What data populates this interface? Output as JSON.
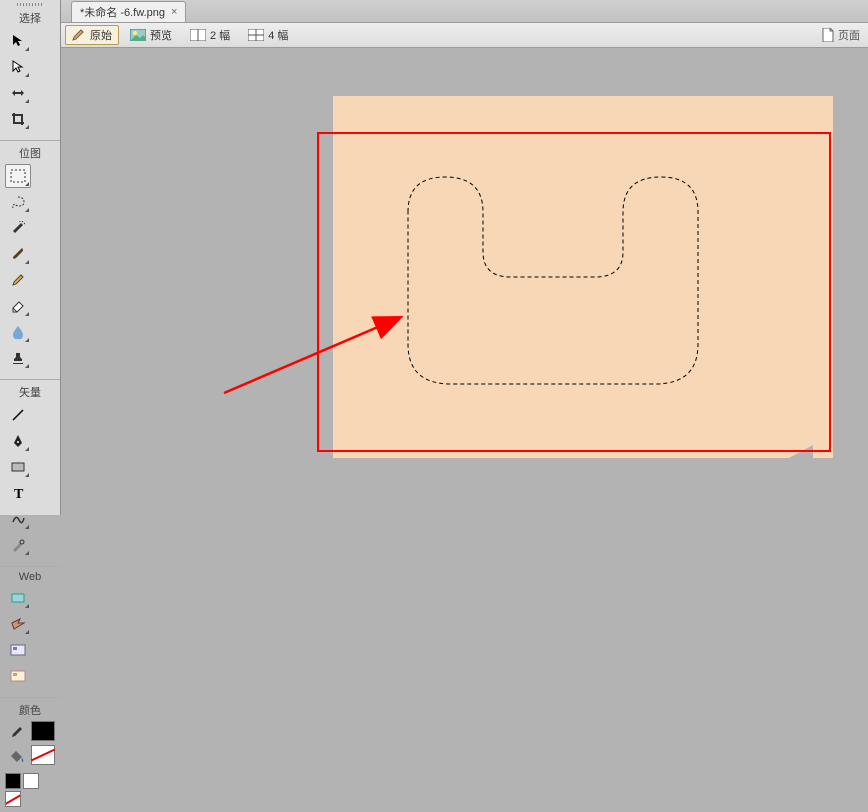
{
  "tab": {
    "title": "*未命名 -6.fw.png",
    "close_label": "×"
  },
  "viewbar": {
    "original": "原始",
    "preview": "预览",
    "split2": "2 幅",
    "split4": "4 幅",
    "page_label": "页面"
  },
  "tools": {
    "group_select": "选择",
    "group_bitmap": "位图",
    "group_vector": "矢量",
    "group_web": "Web",
    "group_color": "颜色"
  }
}
